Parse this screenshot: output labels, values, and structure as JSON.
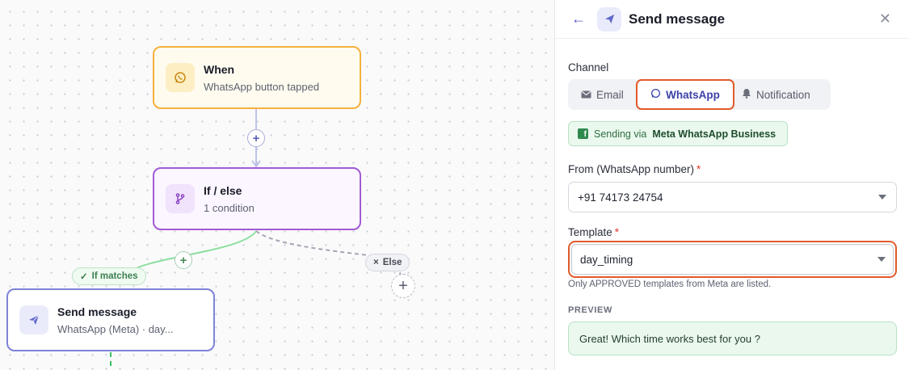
{
  "canvas": {
    "nodes": [
      {
        "id": "when",
        "title": "When",
        "subtitle": "WhatsApp button tapped",
        "icon": "whatsapp-icon"
      },
      {
        "id": "if",
        "title": "If / else",
        "subtitle": "1 condition",
        "icon": "branch-icon"
      },
      {
        "id": "send",
        "title": "Send message",
        "subtitle": "WhatsApp (Meta) · day...",
        "icon": "send-icon"
      }
    ],
    "branch_labels": {
      "match": "If matches",
      "else": "Else"
    },
    "add_symbol": "+",
    "colors": {
      "trigger": "#f5b13d",
      "condition": "#a25ad6",
      "action": "#7d83d8",
      "match_edge": "#8ddf9e",
      "else_edge": "#a3a7b3"
    }
  },
  "panel": {
    "title": "Send message",
    "title_icon": "send-icon",
    "channel": {
      "label": "Channel",
      "options": [
        {
          "label": "Email",
          "icon": "mail-icon",
          "selected": false
        },
        {
          "label": "WhatsApp",
          "icon": "whatsapp-icon",
          "selected": true
        },
        {
          "label": "Notification",
          "icon": "bell-icon",
          "selected": false
        }
      ]
    },
    "banner": {
      "prefix": "Sending via",
      "provider": "Meta WhatsApp Business"
    },
    "from": {
      "label": "From (WhatsApp number)",
      "required_mark": "*",
      "value": "+91 74173 24754"
    },
    "template": {
      "label": "Template",
      "required_mark": "*",
      "value": "day_timing",
      "help": "Only APPROVED templates from Meta are listed."
    },
    "preview": {
      "label": "PREVIEW",
      "text": "Great! Which time works best for you ?"
    },
    "accent": "#5b61c4",
    "highlight": "#e15a2b"
  }
}
